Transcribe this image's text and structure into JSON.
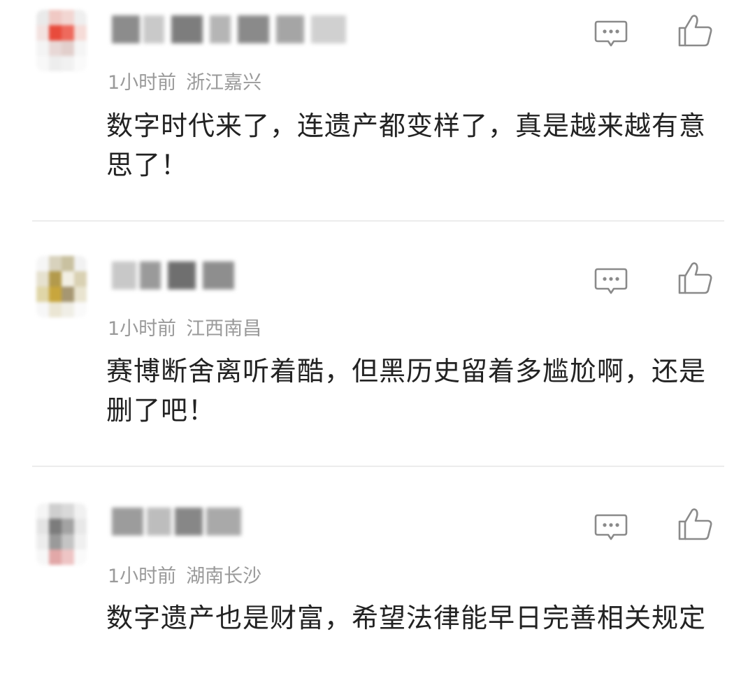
{
  "comments": [
    {
      "time": "1小时前",
      "location": "浙江嘉兴",
      "text": "数字时代来了，连遗产都变样了，真是越来越有意思了！"
    },
    {
      "time": "1小时前",
      "location": "江西南昌",
      "text": "赛博断舍离听着酷，但黑历史留着多尴尬啊，还是删了吧！"
    },
    {
      "time": "1小时前",
      "location": "湖南长沙",
      "text": "数字遗产也是财富，希望法律能早日完善相关规定"
    }
  ],
  "icons": {
    "reply": "comment-bubble-icon",
    "like": "thumbs-up-icon"
  },
  "colors": {
    "text": "#222222",
    "meta": "#9a9a9a",
    "icon": "#8a8a8a",
    "divider": "#ececec"
  }
}
